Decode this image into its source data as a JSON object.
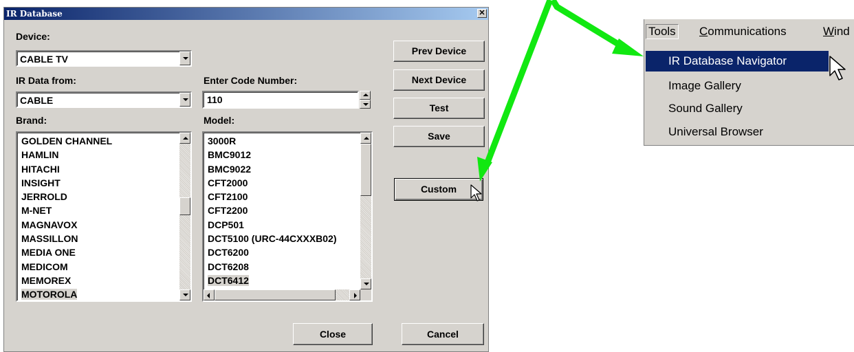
{
  "dialog": {
    "title": "IR Database",
    "close_glyph": "✕",
    "device_label": "Device:",
    "device_value": "CABLE TV",
    "ir_from_label": "IR Data from:",
    "ir_from_value": "CABLE",
    "code_label": "Enter Code Number:",
    "code_value": "110",
    "brand_label": "Brand:",
    "model_label": "Model:",
    "brands": [
      "GOLDEN CHANNEL",
      "HAMLIN",
      "HITACHI",
      "INSIGHT",
      "JERROLD",
      "M-NET",
      "MAGNAVOX",
      "MASSILLON",
      "MEDIA ONE",
      "MEDICOM",
      "MEMOREX",
      "MOTOROLA"
    ],
    "brand_selected": "MOTOROLA",
    "models": [
      "3000R",
      "BMC9012",
      "BMC9022",
      "CFT2000",
      "CFT2100",
      "CFT2200",
      "DCP501",
      "DCT5100 (URC-44CXXXB02)",
      "DCT6200",
      "DCT6208",
      "DCT6412"
    ],
    "model_selected": "DCT6412",
    "buttons": {
      "prev_device": "Prev Device",
      "next_device": "Next Device",
      "test": "Test",
      "save": "Save",
      "custom": "Custom",
      "close": "Close",
      "cancel": "Cancel"
    }
  },
  "menu": {
    "bar": [
      "Tools",
      "Communications",
      "Wind"
    ],
    "items": [
      "IR Database Navigator",
      "Image Gallery",
      "Sound Gallery",
      "Universal Browser"
    ],
    "selected": "IR Database Navigator"
  },
  "colors": {
    "arrow": "#11e811",
    "dialog_bg": "#d6d3ce",
    "title_start": "#0a246a",
    "title_end": "#a6caf0",
    "menu_highlight": "#0a246a"
  }
}
